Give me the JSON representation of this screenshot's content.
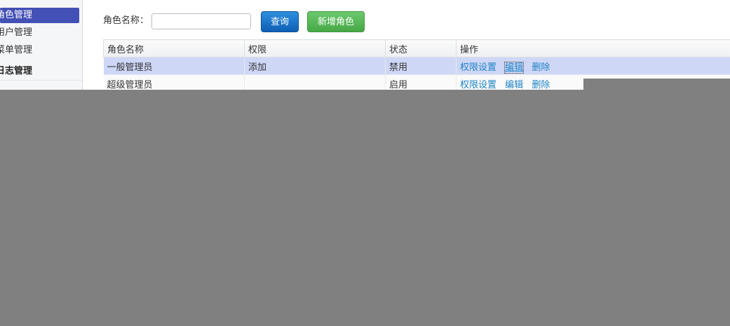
{
  "sidebar": {
    "items": [
      {
        "label": "角色管理",
        "active": true
      },
      {
        "label": "用户管理",
        "active": false
      },
      {
        "label": "菜单管理",
        "active": false
      }
    ],
    "group_label": "日志管理",
    "accent_color": "#4350b5"
  },
  "search": {
    "label": "角色名称：",
    "value": "",
    "placeholder": ""
  },
  "toolbar": {
    "query_label": "查询",
    "add_label": "新增角色",
    "query_color": "#0d5fb5",
    "add_color": "#46a847"
  },
  "table": {
    "columns": [
      "角色名称",
      "权限",
      "状态",
      "操作"
    ],
    "rows": [
      {
        "name": "一般管理员",
        "permission": "添加",
        "status": "禁用",
        "selected": true
      },
      {
        "name": "超级管理员",
        "permission": "",
        "status": "启用",
        "selected": false
      }
    ],
    "actions": [
      "权限设置",
      "编辑",
      "删除"
    ],
    "link_color": "#1f84c5"
  },
  "overlay": {
    "color": "#808080"
  }
}
